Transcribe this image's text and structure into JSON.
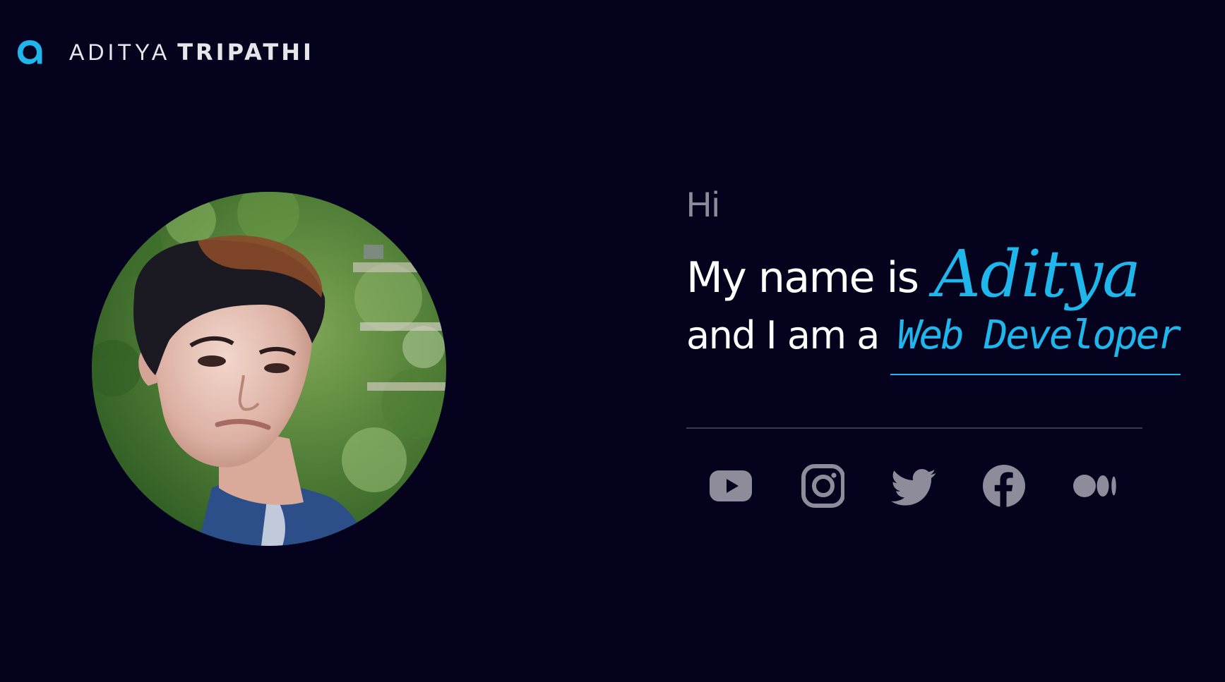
{
  "header": {
    "logo_icon": "letter-a-logo-icon",
    "brand_first": "ADITYA",
    "brand_last": "TRIPATHI"
  },
  "profile": {
    "photo_alt": "Profile photo"
  },
  "intro": {
    "greeting": "Hi",
    "name_prefix": "My name is",
    "name": "Aditya",
    "role_prefix": "and I am a",
    "role": "Web Developer"
  },
  "social": {
    "items": [
      {
        "name": "youtube",
        "icon": "youtube-icon"
      },
      {
        "name": "instagram",
        "icon": "instagram-icon"
      },
      {
        "name": "twitter",
        "icon": "twitter-icon"
      },
      {
        "name": "facebook",
        "icon": "facebook-icon"
      },
      {
        "name": "medium",
        "icon": "medium-icon"
      }
    ]
  },
  "colors": {
    "background": "#04021c",
    "accent": "#1fb6ec",
    "text": "#ffffff",
    "muted": "#8c8b9a",
    "icon": "#8e8c9a"
  }
}
